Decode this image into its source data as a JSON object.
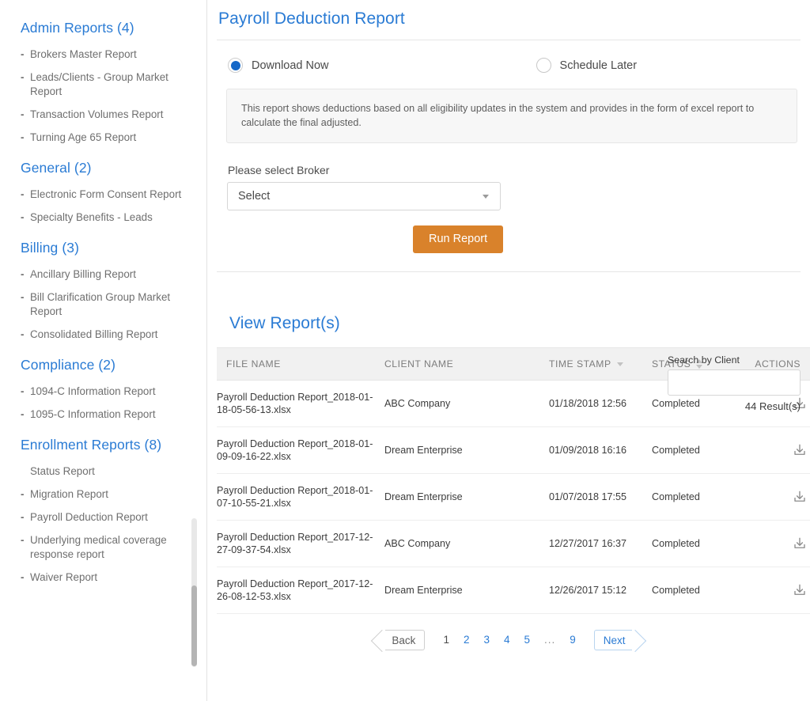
{
  "sidebar": {
    "groups": [
      {
        "title": "Admin Reports (4)",
        "items": [
          {
            "label": "Brokers Master Report",
            "dash": true
          },
          {
            "label": "Leads/Clients - Group Market Report",
            "dash": true
          },
          {
            "label": "Transaction Volumes Report",
            "dash": true
          },
          {
            "label": "Turning Age 65 Report",
            "dash": true
          }
        ]
      },
      {
        "title": "General (2)",
        "items": [
          {
            "label": "Electronic Form Consent Report",
            "dash": true
          },
          {
            "label": "Specialty Benefits - Leads",
            "dash": true
          }
        ]
      },
      {
        "title": "Billing (3)",
        "items": [
          {
            "label": "Ancillary Billing Report",
            "dash": true
          },
          {
            "label": "Bill Clarification Group Market Report",
            "dash": true
          },
          {
            "label": "Consolidated Billing Report",
            "dash": true
          }
        ]
      },
      {
        "title": "Compliance (2)",
        "items": [
          {
            "label": "1094-C Information Report",
            "dash": true
          },
          {
            "label": "1095-C Information Report",
            "dash": true
          }
        ]
      },
      {
        "title": "Enrollment Reports (8)",
        "items": [
          {
            "label": "Status Report",
            "dash": false
          },
          {
            "label": "Migration Report",
            "dash": true
          },
          {
            "label": "Payroll Deduction Report",
            "dash": true
          },
          {
            "label": "Underlying medical coverage response report",
            "dash": true
          },
          {
            "label": "Waiver Report",
            "dash": true
          }
        ]
      }
    ]
  },
  "main": {
    "page_title": "Payroll Deduction Report",
    "radios": [
      {
        "label": "Download Now",
        "selected": true
      },
      {
        "label": "Schedule Later",
        "selected": false
      }
    ],
    "info_text": "This report shows deductions based on all eligibility updates in the system and provides in the form of excel report to calculate the final adjusted.",
    "broker_label": "Please select Broker",
    "broker_value": "Select",
    "run_button": "Run Report",
    "view_title": "View Report(s)",
    "search_label": "Search by Client",
    "search_value": "",
    "result_count": "44 Result(s)",
    "table": {
      "columns": [
        {
          "label": "FILE NAME",
          "sort": "none"
        },
        {
          "label": "CLIENT NAME",
          "sort": "none"
        },
        {
          "label": "TIME STAMP",
          "sort": "desc"
        },
        {
          "label": "STATUS",
          "sort": "both"
        },
        {
          "label": "ACTIONS",
          "sort": "none"
        }
      ],
      "rows": [
        {
          "file": "Payroll Deduction Report_2018-01-18-05-56-13.xlsx",
          "client": "ABC Company",
          "time": "01/18/2018 12:56",
          "status": "Completed",
          "action": "download-icon"
        },
        {
          "file": "Payroll Deduction Report_2018-01-09-09-16-22.xlsx",
          "client": "Dream Enterprise",
          "time": "01/09/2018 16:16",
          "status": "Completed",
          "action": "download-icon"
        },
        {
          "file": "Payroll Deduction Report_2018-01-07-10-55-21.xlsx",
          "client": "Dream Enterprise",
          "time": "01/07/2018 17:55",
          "status": "Completed",
          "action": "download-icon"
        },
        {
          "file": "Payroll Deduction Report_2017-12-27-09-37-54.xlsx",
          "client": "ABC Company",
          "time": "12/27/2017 16:37",
          "status": "Completed",
          "action": "download-icon"
        },
        {
          "file": "Payroll Deduction Report_2017-12-26-08-12-53.xlsx",
          "client": "Dream Enterprise",
          "time": "12/26/2017 15:12",
          "status": "Completed",
          "action": "download-icon"
        }
      ]
    },
    "pagination": {
      "back": "Back",
      "next": "Next",
      "pages": [
        "1",
        "2",
        "3",
        "4",
        "5",
        "...",
        "9"
      ],
      "active": "1"
    }
  },
  "colors": {
    "link_blue": "#2a7bd4",
    "radio_blue": "#1568c8",
    "button_orange": "#d9822b",
    "header_gray": "#f1f1f1",
    "text_gray": "#6f6f6f"
  }
}
